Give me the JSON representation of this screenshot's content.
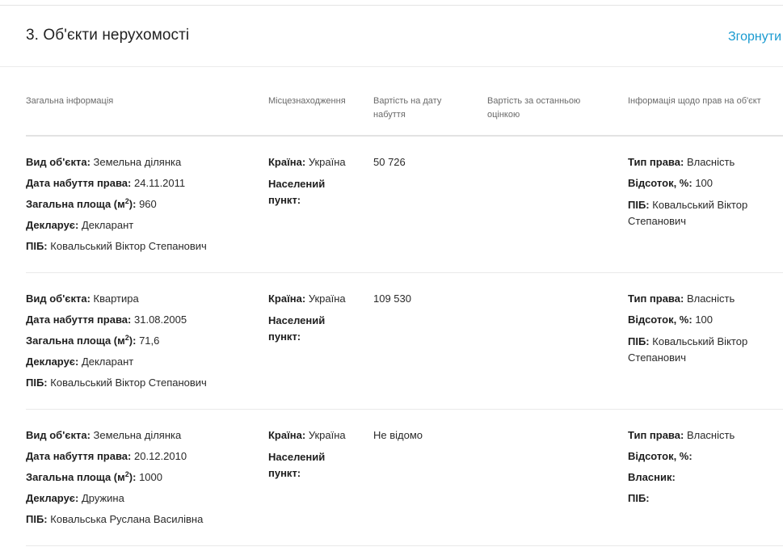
{
  "section": {
    "title": "3. Об'єкти нерухомості",
    "collapse_label": "Згорнути"
  },
  "columns": [
    "Загальна інформація",
    "Місцезнаходження",
    "Вартість на дату набуття",
    "Вартість за останньою оцінкою",
    "Інформація щодо прав на об'єкт"
  ],
  "labels": {
    "object_type": "Вид об'єкта:",
    "acquire_date": "Дата набуття права:",
    "area_prefix": "Загальна площа (м",
    "area_sup": "2",
    "area_suffix": "):",
    "declares": "Декларує:",
    "name": "ПІБ:",
    "country": "Країна:",
    "settlement": "Населений пункт:",
    "right_type": "Тип права:",
    "percent": "Відсоток, %:",
    "owner": "Власник:"
  },
  "rows": [
    {
      "object_type": "Земельна ділянка",
      "acquire_date": "24.11.2011",
      "area": "960",
      "declares": "Декларант",
      "name": "Ковальський Віктор Степанович",
      "country": "Україна",
      "settlement": "",
      "cost_acquire": "50 726",
      "cost_last": "",
      "right_type": "Власність",
      "percent": "100",
      "right_name": "Ковальський Віктор Степанович"
    },
    {
      "object_type": "Квартира",
      "acquire_date": "31.08.2005",
      "area": "71,6",
      "declares": "Декларант",
      "name": "Ковальський Віктор Степанович",
      "country": "Україна",
      "settlement": "",
      "cost_acquire": "109 530",
      "cost_last": "",
      "right_type": "Власність",
      "percent": "100",
      "right_name": "Ковальський Віктор Степанович"
    },
    {
      "object_type": "Земельна ділянка",
      "acquire_date": "20.12.2010",
      "area": "1000",
      "declares": "Дружина",
      "name": "Ковальська Руслана Василівна",
      "country": "Україна",
      "settlement": "",
      "cost_acquire": "Не відомо",
      "cost_last": "",
      "right_type": "Власність",
      "percent": "",
      "owner": "",
      "right_name": ""
    }
  ]
}
